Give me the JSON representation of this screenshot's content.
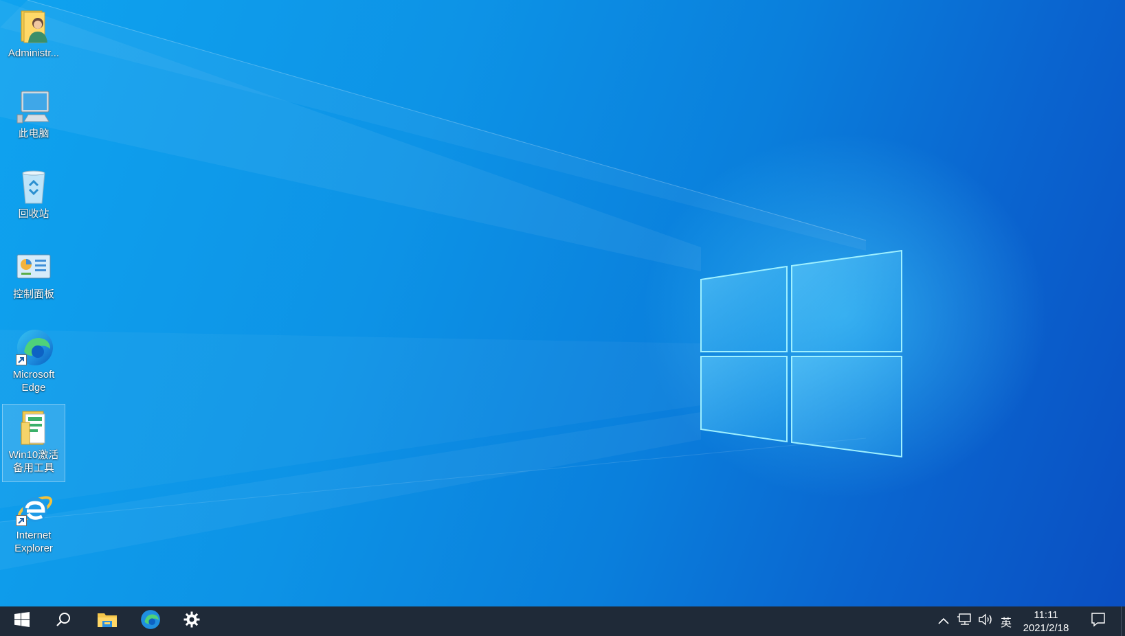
{
  "desktop": {
    "icons": [
      {
        "label": "Administr...",
        "icon": "user-folder-icon"
      },
      {
        "label": "此电脑",
        "icon": "computer-icon"
      },
      {
        "label": "回收站",
        "icon": "recycle-bin-icon"
      },
      {
        "label": "控制面板",
        "icon": "control-panel-icon"
      },
      {
        "label": "Microsoft Edge",
        "icon": "edge-icon",
        "shortcut": true
      },
      {
        "label": "Win10激活备用工具",
        "icon": "folder-icon",
        "selected": true
      },
      {
        "label": "Internet Explorer",
        "icon": "ie-icon",
        "shortcut": true
      }
    ]
  },
  "taskbar": {
    "buttons": [
      {
        "name": "start",
        "icon": "windows-logo-icon"
      },
      {
        "name": "search",
        "icon": "search-icon"
      },
      {
        "name": "file-explorer",
        "icon": "file-explorer-icon"
      },
      {
        "name": "edge",
        "icon": "edge-icon"
      },
      {
        "name": "settings",
        "icon": "gear-icon"
      }
    ],
    "tray": {
      "ime_label": "英",
      "time": "11:11",
      "date": "2021/2/18"
    }
  },
  "colors": {
    "taskbar": "#1f2a38",
    "wallpaper_light": "#0fa3ef",
    "wallpaper_dark": "#0a4fc2"
  }
}
